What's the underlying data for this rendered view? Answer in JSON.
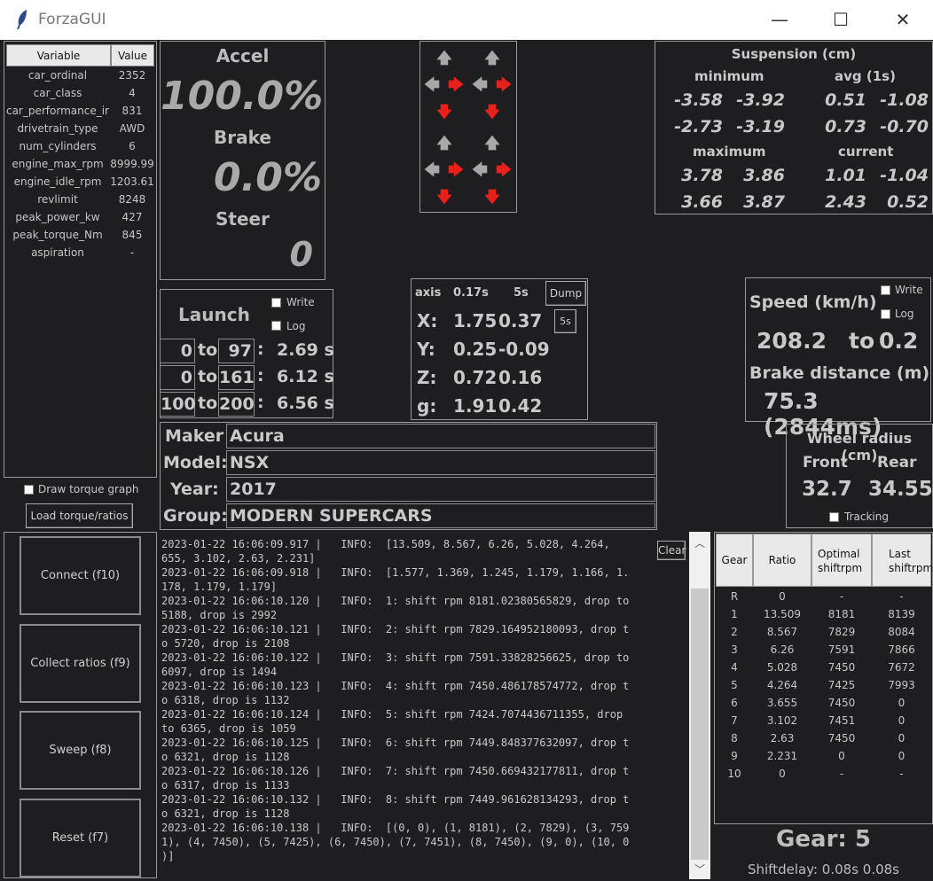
{
  "window": {
    "title": "ForzaGUI"
  },
  "vars": {
    "headers": [
      "Variable",
      "Value"
    ],
    "rows": [
      {
        "name": "car_ordinal",
        "value": "2352"
      },
      {
        "name": "car_class",
        "value": "4"
      },
      {
        "name": "car_performance_ir",
        "value": "831"
      },
      {
        "name": "drivetrain_type",
        "value": "AWD"
      },
      {
        "name": "num_cylinders",
        "value": "6"
      },
      {
        "name": "engine_max_rpm",
        "value": "8999.99"
      },
      {
        "name": "engine_idle_rpm",
        "value": "1203.61"
      },
      {
        "name": "revlimit",
        "value": "8248"
      },
      {
        "name": "peak_power_kw",
        "value": "427"
      },
      {
        "name": "peak_torque_Nm",
        "value": "845"
      },
      {
        "name": "aspiration",
        "value": "-"
      }
    ]
  },
  "controls": {
    "draw_torque": "Draw torque graph",
    "load_torque": "Load torque/ratios",
    "connect": "Connect (f10)",
    "collect": "Collect ratios (f9)",
    "sweep": "Sweep (f8)",
    "reset": "Reset (f7)"
  },
  "pedals": {
    "accel_label": "Accel",
    "accel_value": "100.0%",
    "brake_label": "Brake",
    "brake_value": "0.0%",
    "steer_label": "Steer",
    "steer_value": "0"
  },
  "suspension": {
    "title": "Suspension (cm)",
    "min_label": "minimum",
    "avg_label": "avg (1s)",
    "max_label": "maximum",
    "cur_label": "current",
    "min": [
      "-3.58",
      "-3.92",
      "-2.73",
      "-3.19"
    ],
    "avg": [
      "0.51",
      "-1.08",
      "0.73",
      "-0.70"
    ],
    "max": [
      "3.78",
      "3.86",
      "3.66",
      "3.87"
    ],
    "cur": [
      "1.01",
      "-1.04",
      "2.43",
      "0.52"
    ]
  },
  "launch": {
    "title": "Launch",
    "write": "Write",
    "log": "Log",
    "to": "to",
    "rows": [
      {
        "from": "0",
        "to": "97",
        "time": "2.69 s"
      },
      {
        "from": "0",
        "to": "161",
        "time": "6.12 s"
      },
      {
        "from": "100",
        "to": "200",
        "time": "6.56 s"
      }
    ]
  },
  "accel": {
    "h_axis": "axis",
    "h_short": "0.17s",
    "h_long": "5s",
    "dump": "Dump",
    "period": "5s",
    "rows": [
      {
        "axis": "X:",
        "short": "1.75",
        "long": "0.37"
      },
      {
        "axis": "Y:",
        "short": "0.25",
        "long": "-0.09"
      },
      {
        "axis": "Z:",
        "short": "0.72",
        "long": "0.16"
      },
      {
        "axis": "g:",
        "short": "1.91",
        "long": "0.42"
      }
    ]
  },
  "speed": {
    "title": "Speed (km/h)",
    "write": "Write",
    "log": "Log",
    "from": "208.2",
    "to_word": "to",
    "to": "0.2",
    "brake_title": "Brake distance (m)",
    "brake_value": "75.3 (2844ms)"
  },
  "car": {
    "maker_label": "Maker",
    "maker": "Acura",
    "model_label": "Model:",
    "model": "NSX",
    "year_label": "Year:",
    "year": "2017",
    "group_label": "Group:",
    "group": "MODERN SUPERCARS"
  },
  "wheel": {
    "title": "Wheel radius (cm)",
    "front_label": "Front",
    "rear_label": "Rear",
    "front": "32.7",
    "rear": "34.55",
    "tracking": "Tracking"
  },
  "log": {
    "clear": "Clear",
    "lines": [
      "2023-01-22 16:06:09.917 |   INFO:  [13.509, 8.567, 6.26, 5.028, 4.264,",
      "655, 3.102, 2.63, 2.231]",
      "2023-01-22 16:06:09.918 |   INFO:  [1.577, 1.369, 1.245, 1.179, 1.166, 1.",
      "178, 1.179, 1.179]",
      "2023-01-22 16:06:10.120 |   INFO:  1: shift rpm 8181.02380565829, drop to",
      "5188, drop is 2992",
      "2023-01-22 16:06:10.121 |   INFO:  2: shift rpm 7829.164952180093, drop t",
      "o 5720, drop is 2108",
      "2023-01-22 16:06:10.122 |   INFO:  3: shift rpm 7591.33828256625, drop to",
      "6097, drop is 1494",
      "2023-01-22 16:06:10.123 |   INFO:  4: shift rpm 7450.486178574772, drop t",
      "o 6318, drop is 1132",
      "2023-01-22 16:06:10.124 |   INFO:  5: shift rpm 7424.7074436711355, drop",
      "to 6365, drop is 1059",
      "2023-01-22 16:06:10.125 |   INFO:  6: shift rpm 7449.848377632097, drop t",
      "o 6321, drop is 1128",
      "2023-01-22 16:06:10.126 |   INFO:  7: shift rpm 7450.669432177811, drop t",
      "o 6317, drop is 1133",
      "2023-01-22 16:06:10.132 |   INFO:  8: shift rpm 7449.961628134293, drop t",
      "o 6321, drop is 1128",
      "2023-01-22 16:06:10.138 |   INFO:  [(0, 0), (1, 8181), (2, 7829), (3, 759",
      "1), (4, 7450), (5, 7425), (6, 7450), (7, 7451), (8, 7450), (9, 0), (10, 0",
      ")]"
    ]
  },
  "gears": {
    "headers": [
      "Gear",
      "Ratio",
      "Optimal shiftrpm",
      "Last shiftrpm"
    ],
    "rows": [
      [
        "R",
        "0",
        "-",
        "-"
      ],
      [
        "1",
        "13.509",
        "8181",
        "8139"
      ],
      [
        "2",
        "8.567",
        "7829",
        "8084"
      ],
      [
        "3",
        "6.26",
        "7591",
        "7866"
      ],
      [
        "4",
        "5.028",
        "7450",
        "7672"
      ],
      [
        "5",
        "4.264",
        "7425",
        "7993"
      ],
      [
        "6",
        "3.655",
        "7450",
        "0"
      ],
      [
        "7",
        "3.102",
        "7451",
        "0"
      ],
      [
        "8",
        "2.63",
        "7450",
        "0"
      ],
      [
        "9",
        "2.231",
        "0",
        "0"
      ],
      [
        "10",
        "0",
        "-",
        "-"
      ]
    ],
    "current_gear": "Gear: 5",
    "shiftdelay": "Shiftdelay: 0.08s 0.08s"
  },
  "colors": {
    "background": "#1e1d1f",
    "arrow_active": "#e8211c",
    "arrow_idle": "#a8a8a8"
  }
}
